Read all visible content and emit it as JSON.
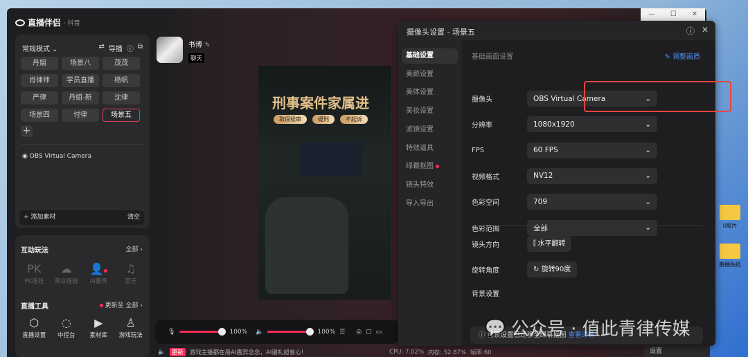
{
  "app": {
    "name": "直播伴侣",
    "platform": "· 抖音"
  },
  "scenes": {
    "mode": "常规模式",
    "guide": "导播",
    "items": [
      "丹姐",
      "场景八",
      "茂茂",
      "肖律师",
      "学员直播",
      "杨帆",
      "严律",
      "丹姐-新",
      "沈律",
      "场景四",
      "付律",
      "场景五"
    ],
    "selected": "场景五",
    "source": "OBS Virtual Camera",
    "add_label": "添加素材",
    "clear_label": "清空"
  },
  "interact": {
    "title": "互动玩法",
    "all": "全部 ›",
    "items": [
      {
        "icon": "pk-icon",
        "label": "PK连线"
      },
      {
        "icon": "audience-link-icon",
        "label": "观众连线"
      },
      {
        "icon": "ai-guest-icon",
        "label": "AI嘉宾"
      },
      {
        "icon": "music-icon",
        "label": "音乐"
      }
    ]
  },
  "tools": {
    "title": "直播工具",
    "update": "更新至",
    "all": "全部 ›",
    "items": [
      {
        "icon": "settings-hex-icon",
        "label": "直播设置"
      },
      {
        "icon": "console-icon",
        "label": "中控台"
      },
      {
        "icon": "media-library-icon",
        "label": "素材库"
      },
      {
        "icon": "game-icon",
        "label": "游戏玩法"
      }
    ]
  },
  "user": {
    "name": "书博",
    "tag": "聊天"
  },
  "preview": {
    "title": "刑事案件家属进",
    "tags": [
      "取保候审",
      "缓刑",
      "不起诉"
    ]
  },
  "controls": {
    "mic_volume": "100%",
    "speaker_volume": "100%",
    "mic_level": 100,
    "speaker_level": 100
  },
  "status": {
    "badge": "更新",
    "message": "游戏主播都在用AI嘉宾念念，AI谢礼超省心!",
    "cpu": "CPU: 7.02%",
    "memory": "内存: 52.87%",
    "fps": "帧率:60"
  },
  "dialog": {
    "title": "摄像头设置 - 场景五",
    "nav": [
      "基础设置",
      "美颜设置",
      "美体设置",
      "美妆设置",
      "滤镜设置",
      "特效道具",
      "绿幕抠图",
      "镜头特效",
      "导入导出"
    ],
    "active_nav": "基础设置",
    "section": "基础画面设置",
    "adjust_link": "调整画质",
    "fields": [
      {
        "label": "摄像头",
        "value": "OBS Virtual Camera"
      },
      {
        "label": "分辨率",
        "value": "1080x1920"
      },
      {
        "label": "FPS",
        "value": "60 FPS"
      },
      {
        "label": "视频格式",
        "value": "NV12"
      },
      {
        "label": "色彩空间",
        "value": "709"
      },
      {
        "label": "色彩范围",
        "value": "全部"
      }
    ],
    "direction_label": "镜头方向",
    "flip_button": "水平翻转",
    "rotate_label": "旋转角度",
    "rotate_button": "旋转90度",
    "bg_label": "背景设置",
    "bg_info": "背景设置已迁移至绿幕抠图",
    "bg_link": "查看详情"
  },
  "desktop": {
    "icons": [
      "li照片",
      "直播贴纸"
    ],
    "taskbar_item": "设置"
  },
  "watermark": "公众号 · 值此青律传媒",
  "colors": {
    "accent": "#fe2c55",
    "highlight_box": "#e5453f",
    "link": "#4d8df7"
  }
}
